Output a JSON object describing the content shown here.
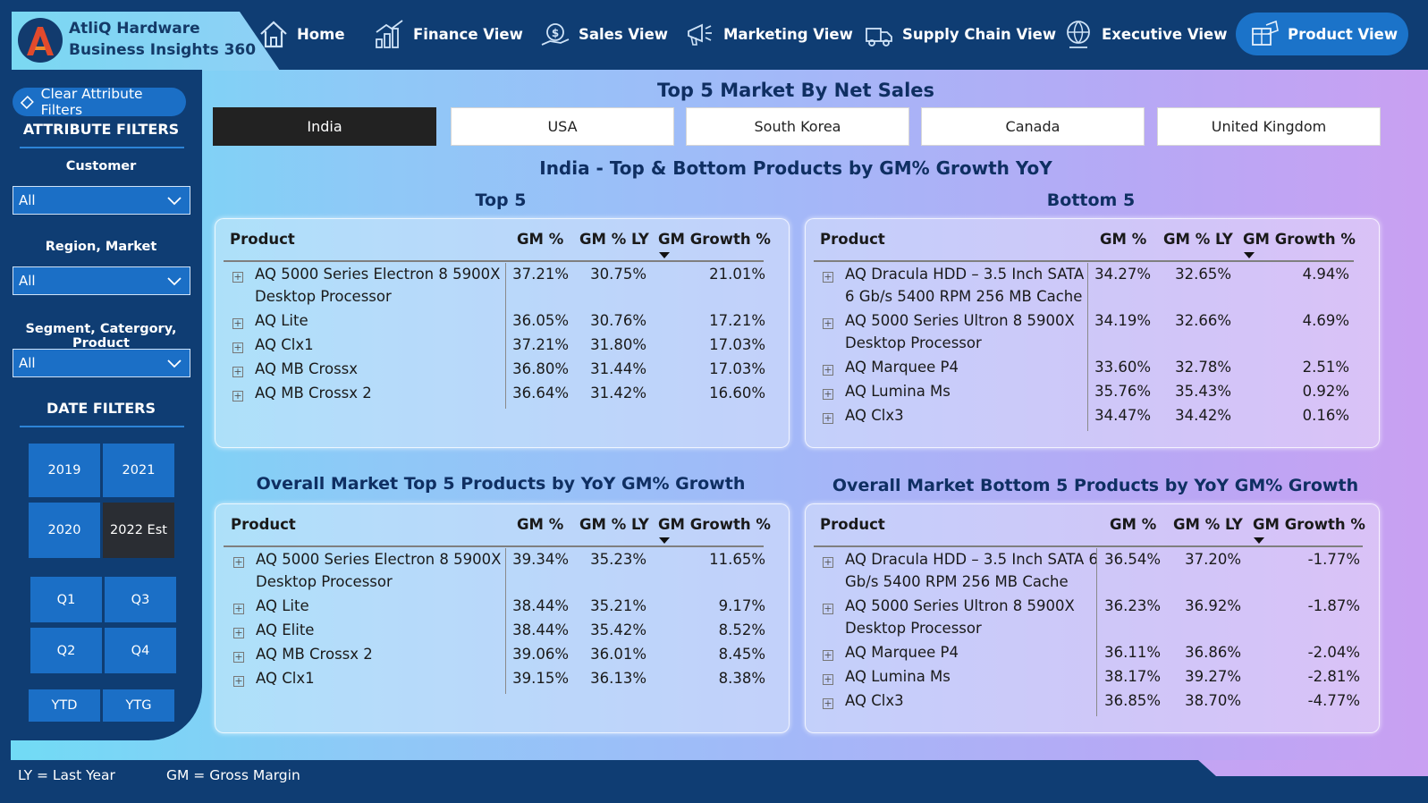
{
  "app": {
    "title_line1": "AtliQ Hardware",
    "title_line2": "Business Insights 360"
  },
  "nav": [
    {
      "label": "Home",
      "icon": "home-icon"
    },
    {
      "label": "Finance View",
      "icon": "finance-icon"
    },
    {
      "label": "Sales View",
      "icon": "sales-icon"
    },
    {
      "label": "Marketing View",
      "icon": "marketing-icon"
    },
    {
      "label": "Supply Chain View",
      "icon": "supply-chain-icon"
    },
    {
      "label": "Executive View",
      "icon": "executive-icon"
    },
    {
      "label": "Product View",
      "icon": "product-icon",
      "active": true
    }
  ],
  "sidebar": {
    "clear_filters": "Clear Attribute Filters",
    "attribute_title": "ATTRIBUTE FILTERS",
    "customer_label": "Customer",
    "customer_value": "All",
    "region_label": "Region, Market",
    "region_value": "All",
    "segment_label": "Segment, Catergory, Product",
    "segment_value": "All",
    "date_title": "DATE FILTERS",
    "years": [
      "2019",
      "2021",
      "2020",
      "2022 Est"
    ],
    "selected_year": "2022 Est",
    "quarters": [
      "Q1",
      "Q3",
      "Q2",
      "Q4"
    ],
    "periods": [
      "YTD",
      "YTG"
    ]
  },
  "markets": {
    "heading": "Top 5 Market By Net Sales",
    "tabs": [
      "India",
      "USA",
      "South Korea",
      "Canada",
      "United Kingdom"
    ],
    "selected": "India"
  },
  "section_heading": "India - Top & Bottom Products by GM% Growth YoY",
  "columns": {
    "product": "Product",
    "gm": "GM %",
    "gm_ly": "GM % LY",
    "growth": "GM Growth %"
  },
  "tables": {
    "top5": {
      "title": "Top 5",
      "rows": [
        {
          "product_l1": "AQ 5000 Series Electron 8 5900X",
          "product_l2": "Desktop Processor",
          "gm": "37.21%",
          "gm_ly": "30.75%",
          "growth": "21.01%"
        },
        {
          "product_l1": "AQ Lite",
          "product_l2": "",
          "gm": "36.05%",
          "gm_ly": "30.76%",
          "growth": "17.21%"
        },
        {
          "product_l1": "AQ Clx1",
          "product_l2": "",
          "gm": "37.21%",
          "gm_ly": "31.80%",
          "growth": "17.03%"
        },
        {
          "product_l1": "AQ MB Crossx",
          "product_l2": "",
          "gm": "36.80%",
          "gm_ly": "31.44%",
          "growth": "17.03%"
        },
        {
          "product_l1": "AQ MB Crossx 2",
          "product_l2": "",
          "gm": "36.64%",
          "gm_ly": "31.42%",
          "growth": "16.60%"
        }
      ]
    },
    "bottom5": {
      "title": "Bottom 5",
      "rows": [
        {
          "product_l1": "AQ Dracula HDD – 3.5 Inch SATA",
          "product_l2": "6 Gb/s 5400 RPM 256 MB Cache",
          "gm": "34.27%",
          "gm_ly": "32.65%",
          "growth": "4.94%"
        },
        {
          "product_l1": "AQ 5000 Series Ultron 8 5900X",
          "product_l2": "Desktop Processor",
          "gm": "34.19%",
          "gm_ly": "32.66%",
          "growth": "4.69%"
        },
        {
          "product_l1": "AQ Marquee P4",
          "product_l2": "",
          "gm": "33.60%",
          "gm_ly": "32.78%",
          "growth": "2.51%"
        },
        {
          "product_l1": "AQ Lumina Ms",
          "product_l2": "",
          "gm": "35.76%",
          "gm_ly": "35.43%",
          "growth": "0.92%"
        },
        {
          "product_l1": "AQ Clx3",
          "product_l2": "",
          "gm": "34.47%",
          "gm_ly": "34.42%",
          "growth": "0.16%"
        }
      ]
    },
    "overall_top5": {
      "title": "Overall Market Top 5 Products by YoY GM% Growth",
      "rows": [
        {
          "product_l1": "AQ 5000 Series Electron 8 5900X",
          "product_l2": "Desktop Processor",
          "gm": "39.34%",
          "gm_ly": "35.23%",
          "growth": "11.65%"
        },
        {
          "product_l1": "AQ Lite",
          "product_l2": "",
          "gm": "38.44%",
          "gm_ly": "35.21%",
          "growth": "9.17%"
        },
        {
          "product_l1": "AQ Elite",
          "product_l2": "",
          "gm": "38.44%",
          "gm_ly": "35.42%",
          "growth": "8.52%"
        },
        {
          "product_l1": "AQ MB Crossx 2",
          "product_l2": "",
          "gm": "39.06%",
          "gm_ly": "36.01%",
          "growth": "8.45%"
        },
        {
          "product_l1": "AQ Clx1",
          "product_l2": "",
          "gm": "39.15%",
          "gm_ly": "36.13%",
          "growth": "8.38%"
        }
      ]
    },
    "overall_bottom5": {
      "title": "Overall Market Bottom 5 Products by YoY GM% Growth",
      "rows": [
        {
          "product_l1": "AQ Dracula HDD – 3.5 Inch SATA 6",
          "product_l2": "Gb/s 5400 RPM 256 MB Cache",
          "gm": "36.54%",
          "gm_ly": "37.20%",
          "growth": "-1.77%"
        },
        {
          "product_l1": "AQ 5000 Series Ultron 8 5900X",
          "product_l2": "Desktop Processor",
          "gm": "36.23%",
          "gm_ly": "36.92%",
          "growth": "-1.87%"
        },
        {
          "product_l1": "AQ Marquee P4",
          "product_l2": "",
          "gm": "36.11%",
          "gm_ly": "36.86%",
          "growth": "-2.04%"
        },
        {
          "product_l1": "AQ Lumina Ms",
          "product_l2": "",
          "gm": "38.17%",
          "gm_ly": "39.27%",
          "growth": "-2.81%"
        },
        {
          "product_l1": "AQ Clx3",
          "product_l2": "",
          "gm": "36.85%",
          "gm_ly": "38.70%",
          "growth": "-4.77%"
        }
      ]
    }
  },
  "footer": {
    "ly": "LY = Last Year",
    "gm": "GM = Gross Margin"
  },
  "colors": {
    "navy": "#0f3d73",
    "accent_blue": "#1b6fc6",
    "active_nav": "#1b73c9",
    "selected_tile": "#2a2d33",
    "heading_text": "#0f2f62"
  }
}
